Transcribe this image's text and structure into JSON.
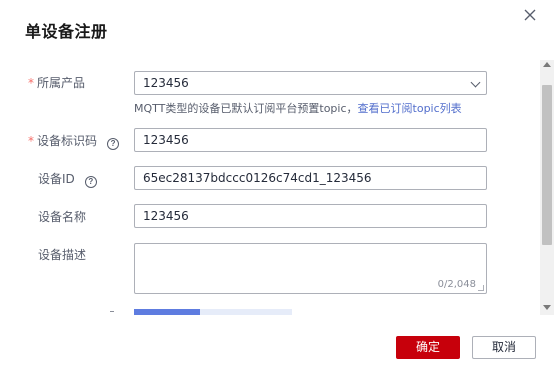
{
  "dialog": {
    "title": "单设备注册",
    "close_icon": "close-icon"
  },
  "form": {
    "required_mark": "*",
    "product": {
      "label": "所属产品",
      "value": "123456",
      "icon": "chevron-down-icon"
    },
    "hint": {
      "text": "MQTT类型的设备已默认订阅平台预置topic，",
      "link": "查看已订阅topic列表"
    },
    "node_id": {
      "label": "设备标识码",
      "help": "?",
      "value": "123456"
    },
    "device_id": {
      "label": "设备ID",
      "help": "?",
      "value": "65ec28137bdccc0126c74cd1_123456"
    },
    "device_name": {
      "label": "设备名称",
      "value": "123456"
    },
    "description": {
      "label": "设备描述",
      "value": "",
      "counter": "0/2,048"
    },
    "progress": {
      "fraction": 0.42
    }
  },
  "footer": {
    "ok_label": "确定",
    "cancel_label": "取消"
  },
  "colors": {
    "primary": "#c7000b",
    "link": "#526ecc",
    "progress": "#5e7ce0",
    "required": "#f66f6a"
  }
}
